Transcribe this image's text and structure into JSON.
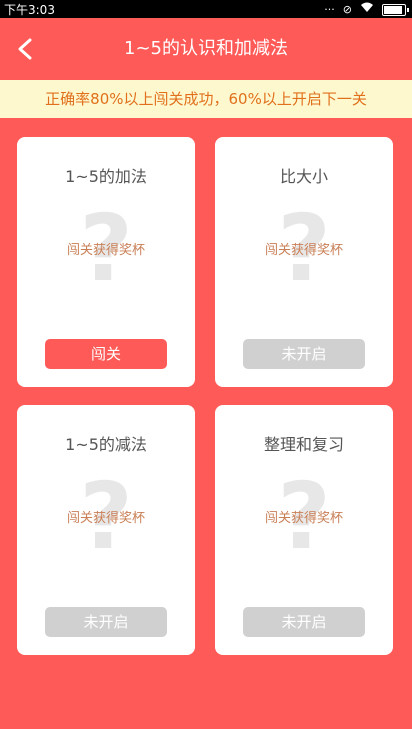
{
  "status": {
    "time": "下午3:03",
    "battery_percent": 90
  },
  "header": {
    "title": "1~5的认识和加减法"
  },
  "notice": "正确率80%以上闯关成功，60%以上开启下一关",
  "cards": [
    {
      "title": "1~5的加法",
      "placeholder": "?",
      "hint": "闯关获得奖杯",
      "button": "闯关"
    },
    {
      "title": "比大小",
      "placeholder": "?",
      "hint": "闯关获得奖杯",
      "button": "未开启"
    },
    {
      "title": "1~5的减法",
      "placeholder": "?",
      "hint": "闯关获得奖杯",
      "button": "未开启"
    },
    {
      "title": "整理和复习",
      "placeholder": "?",
      "hint": "闯关获得奖杯",
      "button": "未开启"
    }
  ],
  "colors": {
    "primary": "#fe5a57",
    "notice_bg": "#fef8cf",
    "notice_text": "#e0701b",
    "locked": "#d0d0d0"
  }
}
